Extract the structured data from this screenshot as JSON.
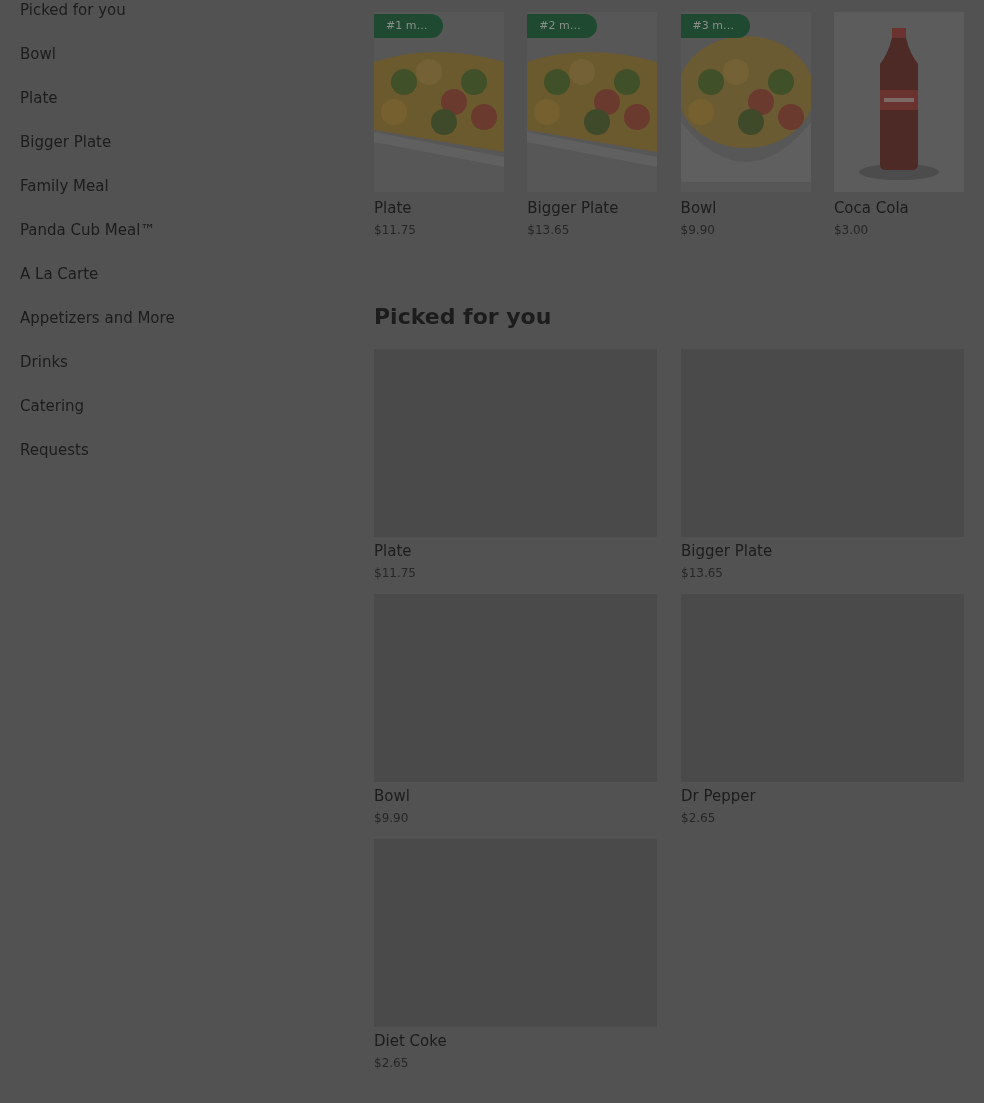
{
  "sidebar": {
    "items": [
      {
        "label": "Picked for you"
      },
      {
        "label": "Bowl"
      },
      {
        "label": "Plate"
      },
      {
        "label": "Bigger Plate"
      },
      {
        "label": "Family Meal"
      },
      {
        "label": "Panda Cub Meal™"
      },
      {
        "label": "A La Carte"
      },
      {
        "label": "Appetizers and More"
      },
      {
        "label": "Drinks"
      },
      {
        "label": "Catering"
      },
      {
        "label": "Requests"
      }
    ]
  },
  "featured": {
    "items": [
      {
        "badge": "#1 m…",
        "name": "Plate",
        "price": "$11.75",
        "kind": "plate"
      },
      {
        "badge": "#2 m…",
        "name": "Bigger Plate",
        "price": "$13.65",
        "kind": "plate"
      },
      {
        "badge": "#3 m…",
        "name": "Bowl",
        "price": "$9.90",
        "kind": "bowl"
      },
      {
        "name": "Coca Cola",
        "price": "$3.00",
        "kind": "bottle"
      }
    ]
  },
  "picked": {
    "title": "Picked for you",
    "items": [
      {
        "name": "Plate",
        "price": "$11.75"
      },
      {
        "name": "Bigger Plate",
        "price": "$13.65"
      },
      {
        "name": "Bowl",
        "price": "$9.90"
      },
      {
        "name": "Dr Pepper",
        "price": "$2.65"
      },
      {
        "name": "Diet Coke",
        "price": "$2.65"
      }
    ]
  }
}
